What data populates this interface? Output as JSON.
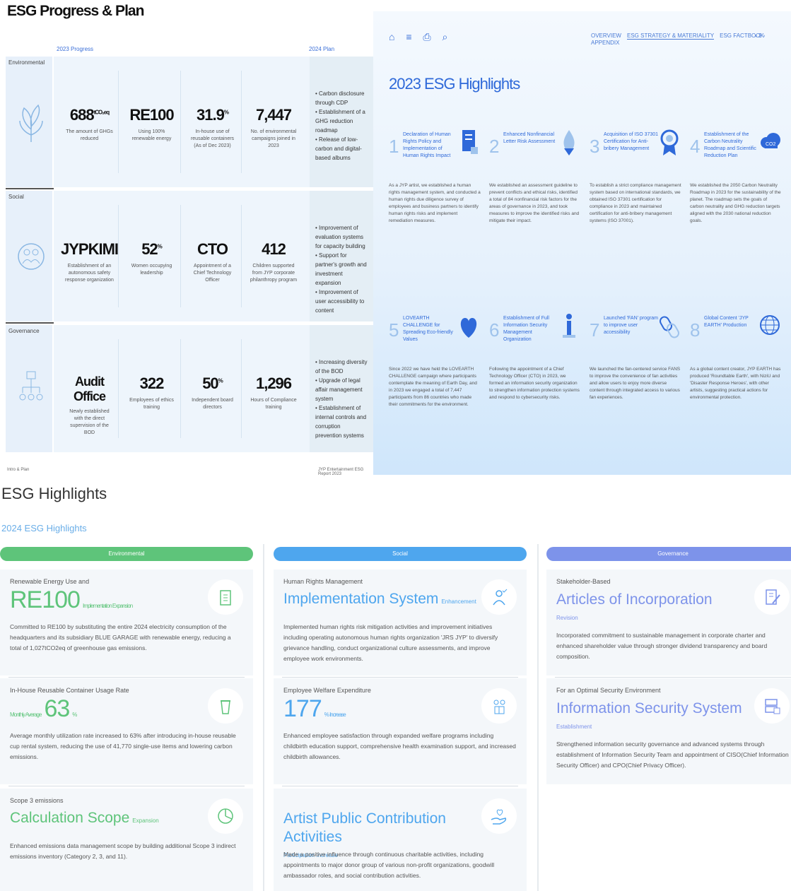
{
  "page1": {
    "title": "ESG Progress & Plan",
    "progress_label": "2023 Progress",
    "plan_label": "2024 Plan",
    "rows": [
      {
        "label": "Environmental",
        "icon": "plant-icon",
        "cells": [
          {
            "big": "688",
            "unit": "tCO₂eq",
            "cap": "The amount of GHGs reduced"
          },
          {
            "big": "RE100",
            "unit": "",
            "cap": "Using 100% renewable energy"
          },
          {
            "big": "31.9",
            "unit": "%",
            "cap": "In-house use of reusable containers (As of Dec 2023)"
          },
          {
            "big": "7,447",
            "unit": "",
            "cap": "No. of environmental campaigns joined in 2023"
          }
        ],
        "plan": "• Carbon disclosure through CDP\n• Establishment of a GHG reduction roadmap\n• Release of low-carbon and digital-based albums"
      },
      {
        "label": "Social",
        "icon": "people-circle-icon",
        "cells": [
          {
            "big": "JYPKIMI",
            "unit": "",
            "cap": "Establishment of an autonomous safety response organization"
          },
          {
            "big": "52",
            "unit": "%",
            "cap": "Women occupying leadership"
          },
          {
            "big": "CTO",
            "unit": "",
            "cap": "Appointment of a Chief Technology Officer"
          },
          {
            "big": "412",
            "unit": "",
            "cap": "Children supported from JYP corporate philanthropy program"
          }
        ],
        "plan": "• Improvement of evaluation systems for capacity building\n• Support for partner's growth and investment expansion\n• Improvement of user accessibility to content"
      },
      {
        "label": "Governance",
        "icon": "org-chart-icon",
        "cells": [
          {
            "big": "Audit Office",
            "unit": "",
            "cap": "Newly established with the direct supervision of the BOD"
          },
          {
            "big": "322",
            "unit": "",
            "cap": "Employees of ethics training"
          },
          {
            "big": "50",
            "unit": "%",
            "cap": "Independent board directors"
          },
          {
            "big": "1,296",
            "unit": "",
            "cap": "Hours of Compliance training"
          }
        ],
        "plan": "• Increasing diversity of the BOD\n• Upgrade of legal affair management system\n• Establishment of internal controls and corruption prevention systems"
      }
    ],
    "footer_left": "Intro & Plan",
    "footer_right": "JYP Entertainment ESG Report 2023"
  },
  "page2": {
    "nav_icons": "⌂ ≡ ⎙ ⌕",
    "nav_tabs": [
      "OVERVIEW",
      "ESG STRATEGY & MATERIALITY",
      "ESG FACTBOOK",
      "APPENDIX"
    ],
    "selected_tab": 1,
    "page_nav": "‹ 3 ›",
    "title": "2023 ESG Highlights",
    "highlights": [
      {
        "n": "1",
        "t": "Declaration of Human Rights Policy and Implementation of Human Rights Impact",
        "icon": "document-icon",
        "d": "As a JYP artist, we established a human rights management system, and conducted a human rights due diligence survey of employees and business partners to identify human rights risks and implement remediation measures."
      },
      {
        "n": "2",
        "t": "Enhanced Nonfinancial Letter Risk Assessment",
        "icon": "shield-drop-icon",
        "d": "We established an assessment guideline to prevent conflicts and ethical risks, identified a total of 84 nonfinancial risk factors for the areas of governance in 2023, and took measures to improve the identified risks and mitigate their impact."
      },
      {
        "n": "3",
        "t": "Acquisition of ISO 37301 Certification for Anti-bribery Management",
        "icon": "award-ribbon-icon",
        "d": "To establish a strict compliance management system based on international standards, we obtained ISO 37301 certification for compliance in 2023 and maintained certification for anti-bribery management systems (ISO 37001)."
      },
      {
        "n": "4",
        "t": "Establishment of the Carbon Neutrality Roadmap and Scientific Reduction Plan",
        "icon": "co2-cloud-icon",
        "d": "We established the 2050 Carbon Neutrality Roadmap in 2023 for the sustainability of the planet. The roadmap sets the goals of carbon neutrality and GHG reduction targets aligned with the 2030 national reduction goals."
      },
      {
        "n": "5",
        "t": "LOVEARTH CHALLENGE for Spreading Eco-friendly Values",
        "icon": "heart-icon",
        "d": "Since 2022 we have held the LOVEARTH CHALLENGE campaign where participants contemplate the meaning of Earth Day, and in 2023 we engaged a total of 7,447 participants from 86 countries who made their commitments for the environment."
      },
      {
        "n": "6",
        "t": "Establishment of Full Information Security Management Organization",
        "icon": "person-info-icon",
        "d": "Following the appointment of a Chief Technology Officer (CTO) in 2023, we formed an information security organization to strengthen information protection systems and respond to cybersecurity risks."
      },
      {
        "n": "7",
        "t": "Launched 'FAN' program to improve user accessibility",
        "icon": "link-chain-icon",
        "d": "We launched the fan-centered service FANS to improve the convenience of fan activities and allow users to enjoy more diverse content through integrated access to various fan experiences."
      },
      {
        "n": "8",
        "t": "Global Content 'JYP EARTH' Production",
        "icon": "globe-icon",
        "d": "As a global content creator, JYP EARTH has produced 'Roundtable Earth', with NiziU and 'Disaster Response Heroes', with other artists, suggesting practical actions for environmental protection."
      }
    ]
  },
  "section3": {
    "title": "ESG Highlights",
    "subtitle": "2024 ESG Highlights",
    "columns": [
      {
        "header": "Environmental",
        "color": "#5ec47a",
        "cards": [
          {
            "key": "Renewable Energy Use and",
            "value": "RE100",
            "tag": "Implementation Expansion",
            "icon": "building-icon",
            "desc": "Committed to RE100 by substituting the entire 2024 electricity consumption of the headquarters and its subsidiary BLUE GARAGE with renewable energy, reducing a total of 1,027tCO2eq of greenhouse gas emissions."
          },
          {
            "key": "In-House Reusable Container Usage Rate",
            "value": "63",
            "prefix": "Monthly Average",
            "tag": "%",
            "icon": "cup-icon",
            "desc": "Average monthly utilization rate increased to 63% after introducing in-house reusable cup rental system, reducing the use of 41,770 single-use items and lowering carbon emissions."
          },
          {
            "key": "Scope 3 emissions",
            "value": "Calculation Scope",
            "tag": "Expansion",
            "icon": "pie-chart-icon",
            "desc": "Enhanced emissions data management scope by building additional Scope 3 indirect emissions inventory (Category 2, 3, and 11)."
          }
        ]
      },
      {
        "header": "Social",
        "color": "#4ea6ee",
        "cards": [
          {
            "key": "Human Rights Management",
            "value": "Implementation System",
            "tag": "Enhancement",
            "icon": "person-check-icon",
            "desc": "Implemented human rights risk mitigation activities and improvement initiatives including operating autonomous human rights organization 'JRS JYP' to diversify grievance handling, conduct organizational culture assessments, and improve employee work environments."
          },
          {
            "key": "Employee Welfare Expenditure",
            "value": "177",
            "tag": "% Increase",
            "icon": "people-gift-icon",
            "desc": "Enhanced employee satisfaction through expanded welfare programs including childbirth education support, comprehensive health examination support, and increased childbirth allowances."
          },
          {
            "key": "",
            "value": "Artist Public Contribution Activities",
            "tag": "Participation Increase",
            "icon": "hand-heart-icon",
            "desc": "Made a positive influence through continuous charitable activities, including appointments to major donor group of various non-profit organizations, goodwill ambassador roles, and social contribution activities."
          }
        ]
      },
      {
        "header": "Governance",
        "color": "#7d93ea",
        "cards": [
          {
            "key": "Stakeholder-Based",
            "value": "Articles of Incorporation",
            "tag": "Revision",
            "icon": "document-edit-icon",
            "desc": "Incorporated commitment to sustainable management in corporate charter and enhanced shareholder value through stronger dividend transparency and board composition."
          },
          {
            "key": "For an Optimal Security Environment",
            "value": "Information Security System",
            "tag": "Establishment",
            "icon": "server-lock-icon",
            "desc": "Strengthened information security governance and advanced systems through establishment of Information Security Team and appointment of CISO(Chief Information Security Officer) and CPO(Chief Privacy Officer)."
          }
        ]
      }
    ]
  }
}
